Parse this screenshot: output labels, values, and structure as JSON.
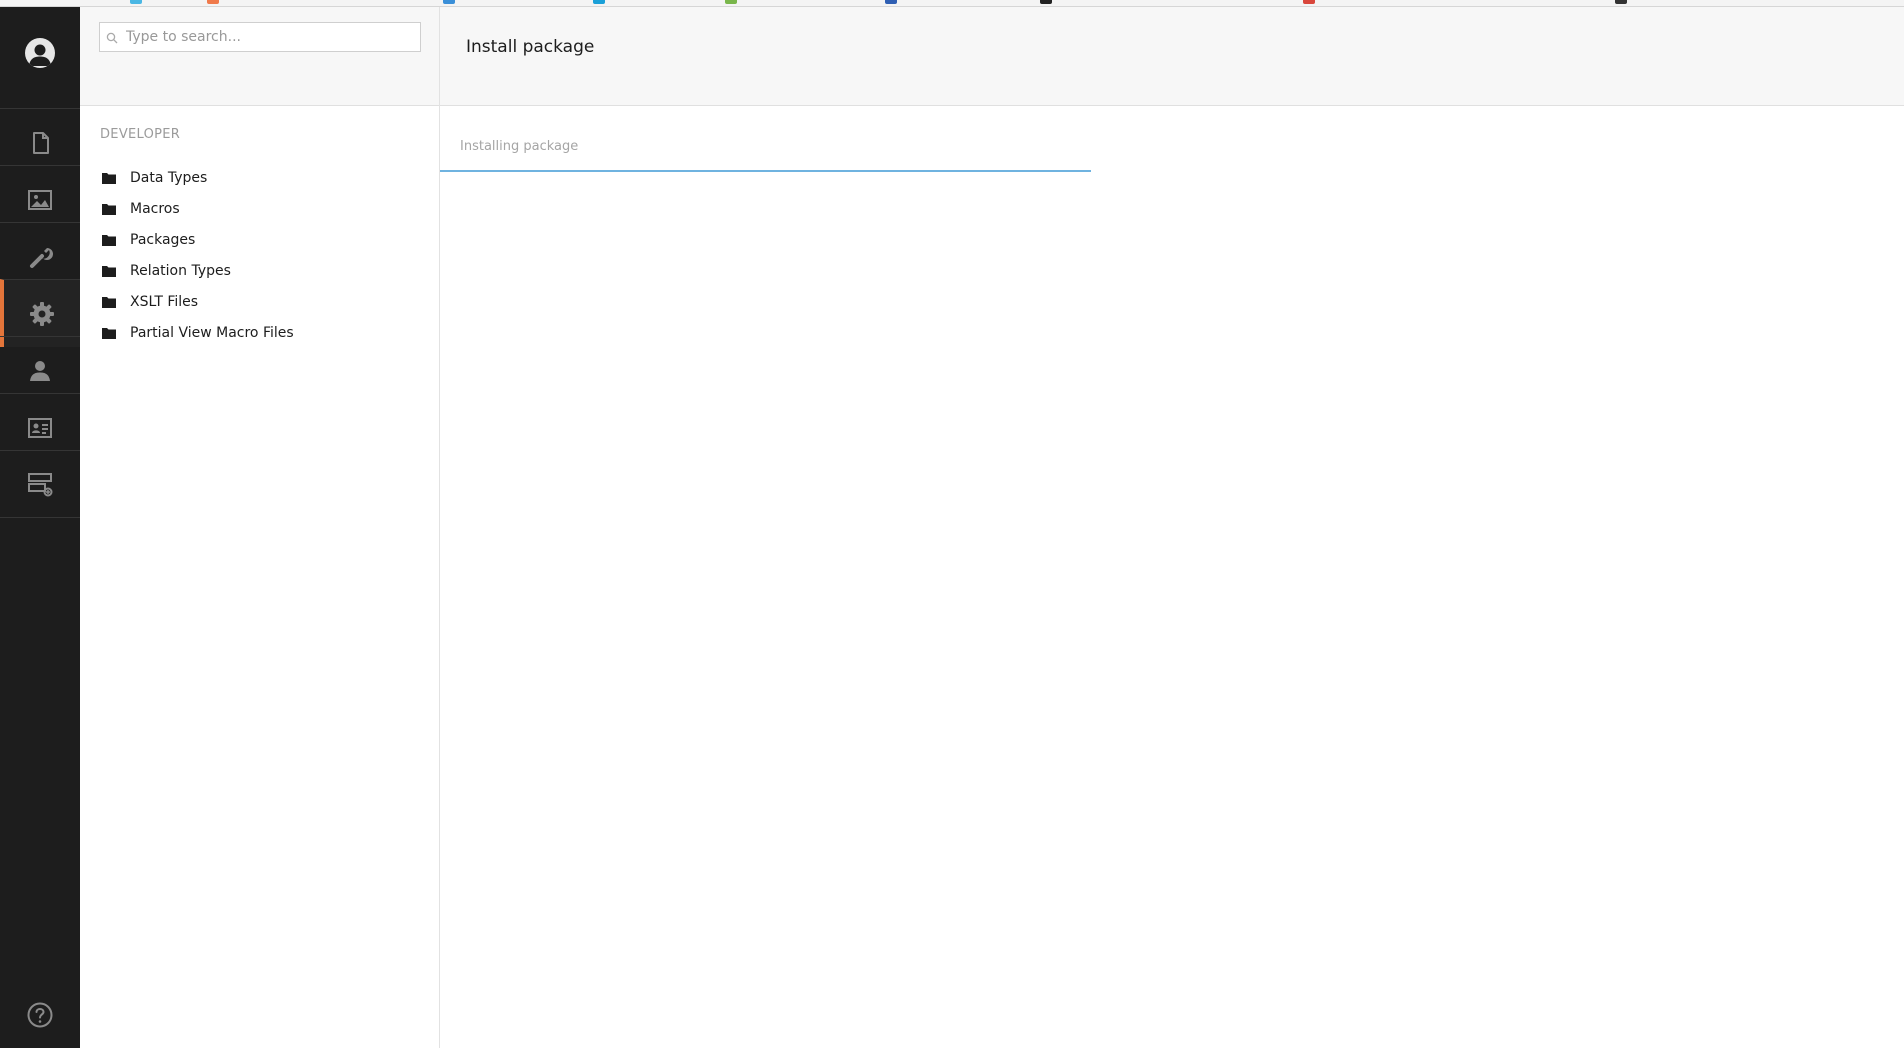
{
  "colors": {
    "nav_bg": "#1d1d1d",
    "active_accent": "#e4753a",
    "progress": "#6fb3e0"
  },
  "nav": {
    "sections": [
      {
        "icon": "document-icon"
      },
      {
        "icon": "media-image-icon"
      },
      {
        "icon": "wrench-icon"
      },
      {
        "icon": "gear-icon",
        "active": true
      },
      {
        "icon": "user-icon"
      },
      {
        "icon": "member-card-icon"
      },
      {
        "icon": "forms-icon"
      }
    ],
    "help_icon": "help-icon"
  },
  "search": {
    "placeholder": "Type to search..."
  },
  "tree": {
    "section_title": "DEVELOPER",
    "items": [
      {
        "label": "Data Types",
        "icon": "folder-icon"
      },
      {
        "label": "Macros",
        "icon": "folder-icon"
      },
      {
        "label": "Packages",
        "icon": "folder-icon"
      },
      {
        "label": "Relation Types",
        "icon": "folder-icon"
      },
      {
        "label": "XSLT Files",
        "icon": "folder-icon"
      },
      {
        "label": "Partial View Macro Files",
        "icon": "folder-icon"
      }
    ]
  },
  "main": {
    "title": "Install package",
    "status": "Installing package",
    "progress": 1.0
  }
}
